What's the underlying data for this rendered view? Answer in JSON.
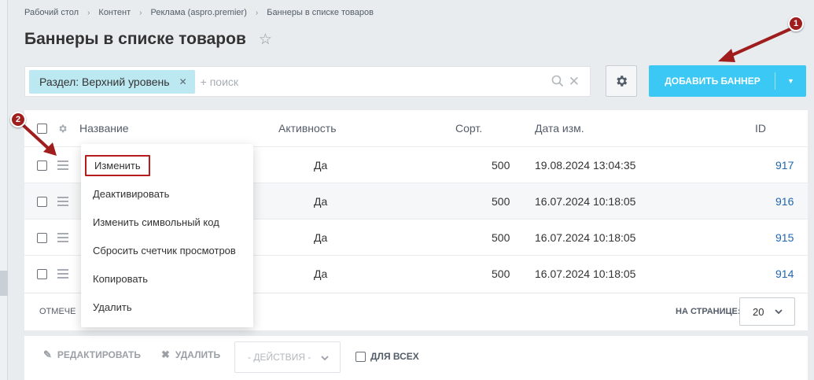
{
  "breadcrumb": [
    "Рабочий стол",
    "Контент",
    "Реклама (aspro.premier)",
    "Баннеры в списке товаров"
  ],
  "page_title": "Баннеры в списке товаров",
  "filter": {
    "chip_label": "Раздел: Верхний уровень",
    "placeholder": "+ поиск"
  },
  "add_button": {
    "label": "ДОБАВИТЬ БАННЕР"
  },
  "table": {
    "columns": [
      "Название",
      "Активность",
      "Сорт.",
      "Дата изм.",
      "ID"
    ],
    "rows": [
      {
        "active": "Да",
        "sort": "500",
        "date": "19.08.2024 13:04:35",
        "id": "917"
      },
      {
        "active": "Да",
        "sort": "500",
        "date": "16.07.2024 10:18:05",
        "id": "916"
      },
      {
        "active": "Да",
        "sort": "500",
        "date": "16.07.2024 10:18:05",
        "id": "915"
      },
      {
        "active": "Да",
        "sort": "500",
        "date": "16.07.2024 10:18:05",
        "id": "914"
      }
    ]
  },
  "footer": {
    "selected_label": "ОТМЕЧЕ",
    "per_page_label": "НА СТРАНИЦЕ:",
    "per_page_value": "20"
  },
  "actions": {
    "edit": "РЕДАКТИРОВАТЬ",
    "delete": "УДАЛИТЬ",
    "actions_select": "- ДЕЙСТВИЯ -",
    "for_all": "ДЛЯ ВСЕХ"
  },
  "context_menu": [
    "Изменить",
    "Деактивировать",
    "Изменить символьный код",
    "Сбросить счетчик просмотров",
    "Копировать",
    "Удалить"
  ],
  "annotations": {
    "badge_1": "1",
    "badge_2": "2"
  },
  "colors": {
    "accent": "#3bc8f5",
    "chip": "#bce8f1",
    "annotation": "#a01d1d",
    "link": "#2067b0"
  }
}
